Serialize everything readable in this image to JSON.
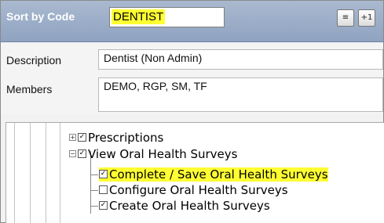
{
  "header": {
    "sort_label": "Sort by Code",
    "code_value": "DENTIST",
    "buttons": [
      {
        "label": "≡",
        "icon": "align-icon"
      },
      {
        "label": "+1",
        "icon": "plus-one-icon"
      }
    ]
  },
  "details": {
    "description_label": "Description",
    "description_value": "Dentist (Non Admin)",
    "members_label": "Members",
    "members_value": "DEMO, RGP, SM, TF"
  },
  "tree": {
    "nodes": [
      {
        "label": "Prescriptions",
        "checked": true,
        "expander": "+",
        "highlighted": false
      },
      {
        "label": "View Oral Health Surveys",
        "checked": true,
        "expander": "−",
        "highlighted": false
      },
      {
        "label": "Complete / Save Oral Health Surveys",
        "checked": true,
        "highlighted": true
      },
      {
        "label": "Configure Oral Health Surveys",
        "checked": false,
        "highlighted": false
      },
      {
        "label": "Create Oral Health Surveys",
        "checked": true,
        "highlighted": false
      }
    ]
  },
  "colors": {
    "header_bg": "#9aadc8",
    "highlight": "#ffff33"
  }
}
